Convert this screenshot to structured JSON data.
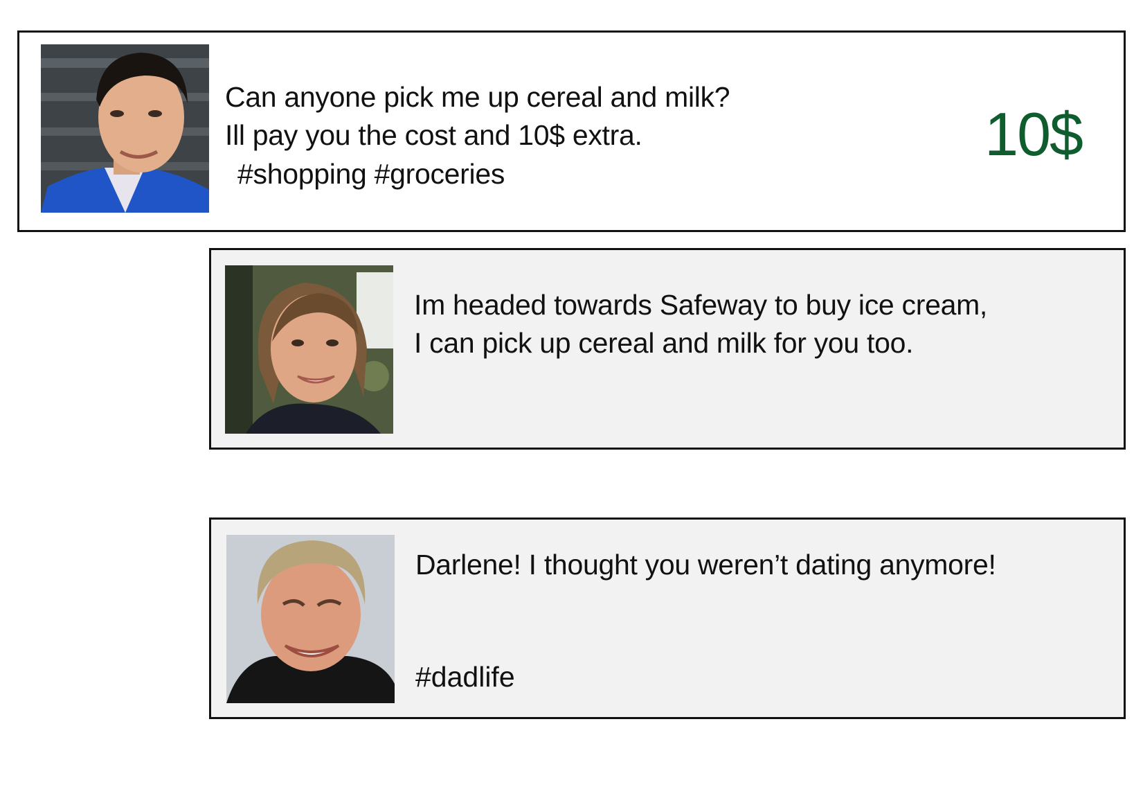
{
  "posts": {
    "request": {
      "avatar_icon": "young-man-avatar",
      "line1": "Can anyone pick me up cereal and milk?",
      "line2": "Ill pay you the cost and 10$ extra.",
      "hashtags": "#shopping #groceries",
      "reward": "10$",
      "reward_color": "#0f5c2e"
    },
    "reply_1": {
      "avatar_icon": "young-woman-avatar",
      "line1": "Im headed towards Safeway to buy ice cream,",
      "line2": "I can pick up cereal and milk for you too."
    },
    "reply_2": {
      "avatar_icon": "older-man-avatar",
      "line1": "Darlene! I thought you weren’t dating anymore!",
      "hashtags": "#dadlife"
    }
  },
  "colors": {
    "card_border": "#111111",
    "reply_background": "#f2f2f2"
  }
}
